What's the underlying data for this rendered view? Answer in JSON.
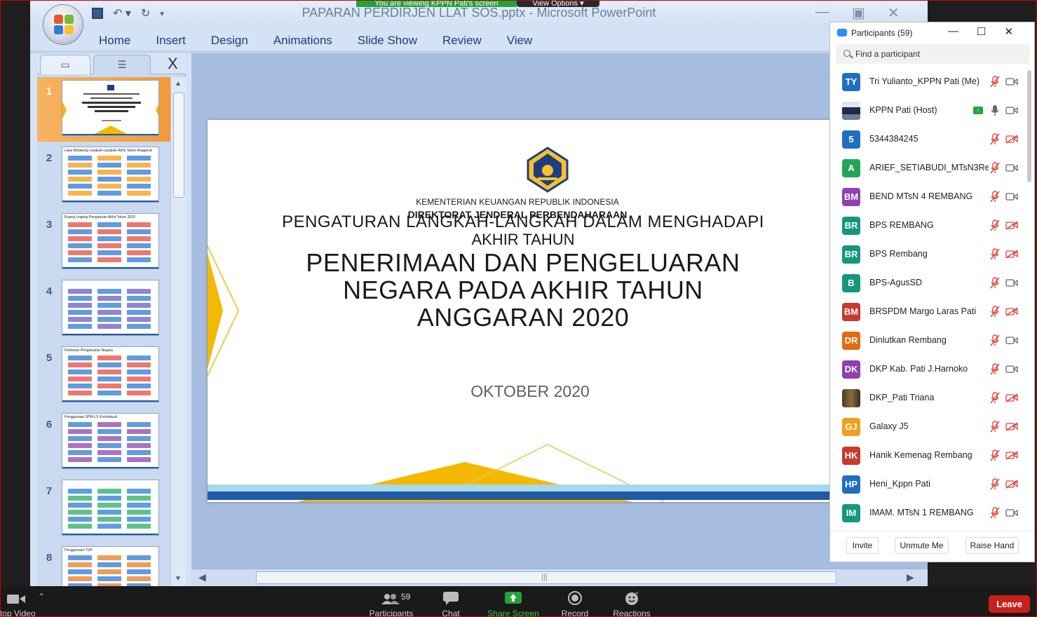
{
  "banner": {
    "message": "You are viewing KPPN Pati's screen",
    "options": "View Options ▾"
  },
  "ppt": {
    "title": "PAPARAN PERDIRJEN LLAT SOS.pptx - Microsoft PowerPoint",
    "ribbon_tabs": [
      "Home",
      "Insert",
      "Design",
      "Animations",
      "Slide Show",
      "Review",
      "View"
    ],
    "window_controls": [
      "—",
      "▣",
      "✕"
    ],
    "qat": [
      "save-icon",
      "undo-icon",
      "redo-icon",
      "customize-icon"
    ],
    "pane_close": "X",
    "slide_numbers": [
      "1",
      "2",
      "3",
      "4",
      "5",
      "6",
      "7",
      "8"
    ],
    "thumb_titles": [
      "",
      "Latar Belakang Langkah-Langkah Akhir Tahun Anggaran",
      "Ruang Lingkup Pengaturan Akhir Tahun 2020",
      "",
      "Pedoman Pengeluaran Negara",
      "Penggunaan SPM-LS Kontraktual",
      "",
      "Penggunaan TUP"
    ],
    "selected_slide": 1
  },
  "slide": {
    "org1": "KEMENTERIAN KEUANGAN REPUBLIK INDONESIA",
    "org2": "DIREKTORAT JENDERAL PERBENDAHARAAN",
    "sub1": "PENGATURAN LANGKAH-LANGKAH DALAM MENGHADAPI",
    "sub2": "AKHIR TAHUN",
    "main1": "PENERIMAAN DAN PENGELUARAN",
    "main2": "NEGARA PADA AKHIR TAHUN",
    "main3": "ANGGARAN 2020",
    "date": "OKTOBER 2020"
  },
  "participants_panel": {
    "title": "Participants (59)",
    "search_placeholder": "Find a participant",
    "controls": [
      "—",
      "☐",
      "✕"
    ],
    "participants": [
      {
        "initials": "TY",
        "name": "Tri Yulianto_KPPN Pati (Me)",
        "color": "#1f6fbf",
        "mic": "muted",
        "video": "on"
      },
      {
        "initials": "",
        "name": "KPPN Pati (Host)",
        "color": "#2b3a55",
        "mic": "on",
        "video": "on",
        "sharing": true,
        "photo": true
      },
      {
        "initials": "5",
        "name": "5344384245",
        "color": "#1f6fbf",
        "mic": "muted",
        "video": "off"
      },
      {
        "initials": "A",
        "name": "ARIEF_SETIABUDI_MTsN3Re...",
        "color": "#23a45a",
        "mic": "muted",
        "video": "on"
      },
      {
        "initials": "BM",
        "name": "BEND MTsN 4 REMBANG",
        "color": "#8e3fb0",
        "mic": "muted",
        "video": "on"
      },
      {
        "initials": "BR",
        "name": "BPS REMBANG",
        "color": "#17967e",
        "mic": "muted",
        "video": "off"
      },
      {
        "initials": "BR",
        "name": "BPS Rembang",
        "color": "#17967e",
        "mic": "muted",
        "video": "off"
      },
      {
        "initials": "B",
        "name": "BPS-AgusSD",
        "color": "#17967e",
        "mic": "muted",
        "video": "on"
      },
      {
        "initials": "BM",
        "name": "BRSPDM Margo Laras Pati",
        "color": "#c63a2f",
        "mic": "muted",
        "video": "off"
      },
      {
        "initials": "DR",
        "name": "Dinlutkan Rembang",
        "color": "#e06b10",
        "mic": "muted",
        "video": "on"
      },
      {
        "initials": "DK",
        "name": "DKP Kab. Pati J.Harnoko",
        "color": "#8e3fb0",
        "mic": "muted",
        "video": "on"
      },
      {
        "initials": "",
        "name": "DKP_Pati Triana",
        "color": "#6e5a3a",
        "mic": "muted",
        "video": "off",
        "photo": true
      },
      {
        "initials": "GJ",
        "name": "Galaxy J5",
        "color": "#f0a020",
        "mic": "muted",
        "video": "off"
      },
      {
        "initials": "HK",
        "name": "Hanik Kemenag Rembang",
        "color": "#c63a2f",
        "mic": "muted",
        "video": "off"
      },
      {
        "initials": "HP",
        "name": "Heni_Kppn Pati",
        "color": "#1f6fbf",
        "mic": "muted",
        "video": "off"
      },
      {
        "initials": "IM",
        "name": "IMAM. MTsN 1 REMBANG",
        "color": "#17967e",
        "mic": "muted",
        "video": "on"
      }
    ],
    "footer_buttons": [
      "Invite",
      "Unmute Me",
      "Raise Hand"
    ]
  },
  "toolbar": {
    "stop_video": "top Video",
    "participants_count": "59",
    "participants": "Participants",
    "chat": "Chat",
    "share_screen": "Share Screen",
    "record": "Record",
    "reactions": "Reactions",
    "leave": "Leave"
  },
  "colors": {
    "share_green": "#22a33a",
    "leave_red": "#c7211c",
    "slide_gold": "#f5b800",
    "ppt_blue": "#1e3f73"
  }
}
